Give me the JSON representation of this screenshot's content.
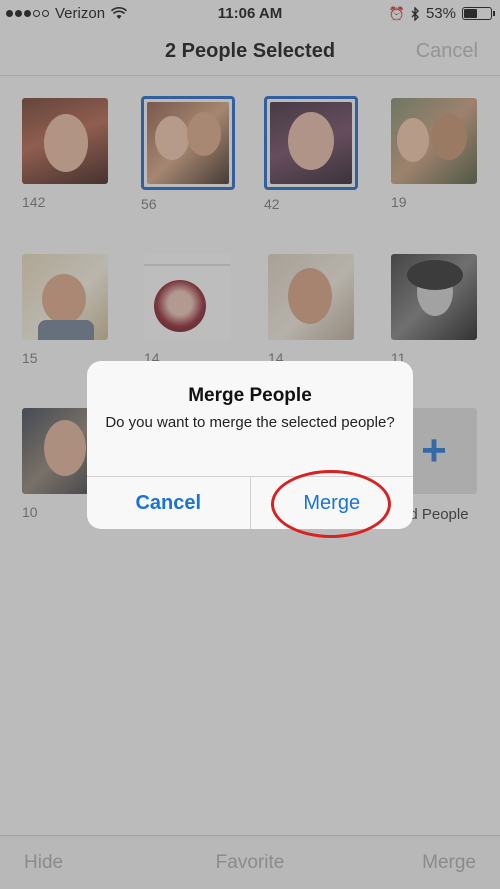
{
  "status_bar": {
    "carrier": "Verizon",
    "time": "11:06 AM",
    "battery": "53%",
    "battery_level": 0.53
  },
  "nav": {
    "title": "2 People Selected",
    "cancel": "Cancel"
  },
  "people": [
    {
      "count": "142",
      "selected": false
    },
    {
      "count": "56",
      "selected": true
    },
    {
      "count": "42",
      "selected": true
    },
    {
      "count": "19",
      "selected": false
    },
    {
      "count": "15",
      "selected": false
    },
    {
      "count": "14",
      "selected": false
    },
    {
      "count": "14",
      "selected": false
    },
    {
      "count": "11",
      "selected": false
    },
    {
      "count": "10",
      "selected": false
    }
  ],
  "add_people": {
    "label": "Add People"
  },
  "alert": {
    "title": "Merge People",
    "message": "Do you want to merge the selected people?",
    "cancel": "Cancel",
    "confirm": "Merge"
  },
  "toolbar": {
    "hide": "Hide",
    "favorite": "Favorite",
    "merge": "Merge"
  },
  "colors": {
    "accent": "#1a73d6",
    "selection": "#1b64c8",
    "highlight_circle": "#d62222"
  }
}
